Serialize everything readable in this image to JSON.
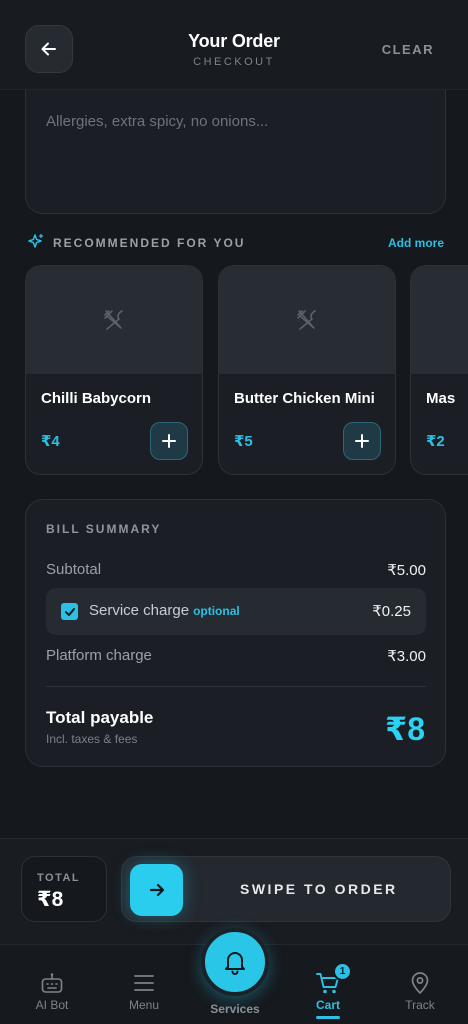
{
  "header": {
    "title": "Your Order",
    "subtitle": "CHECKOUT",
    "clear_label": "CLEAR",
    "back_icon": "arrow-left-icon"
  },
  "notes": {
    "placeholder": "Allergies, extra spicy, no onions..."
  },
  "recommended": {
    "title": "RECOMMENDED FOR YOU",
    "add_more_label": "Add more",
    "items": [
      {
        "name": "Chilli Babycorn",
        "price": "₹4"
      },
      {
        "name": "Butter Chicken Mini",
        "price": "₹5"
      },
      {
        "name": "Mas",
        "price": "₹2"
      }
    ]
  },
  "bill": {
    "title": "BILL SUMMARY",
    "subtotal_label": "Subtotal",
    "subtotal_value": "₹5.00",
    "service_label": "Service charge",
    "service_optional": "optional",
    "service_value": "₹0.25",
    "service_checked": true,
    "platform_label": "Platform charge",
    "platform_value": "₹3.00",
    "total_label": "Total payable",
    "total_sub": "Incl. taxes & fees",
    "total_value": "₹8"
  },
  "checkout": {
    "total_label": "TOTAL",
    "total_value": "₹8",
    "swipe_label": "SWIPE TO ORDER"
  },
  "nav": {
    "items": [
      {
        "label": "AI Bot",
        "icon": "robot-icon"
      },
      {
        "label": "Menu",
        "icon": "menu-icon"
      },
      {
        "label": "Services",
        "icon": "bell-icon"
      },
      {
        "label": "Cart",
        "icon": "cart-icon",
        "active": true,
        "badge": "1"
      },
      {
        "label": "Track",
        "icon": "location-pin-icon"
      }
    ]
  },
  "colors": {
    "accent": "#2bc0e4",
    "background": "#15181d",
    "card": "#1b1e24"
  }
}
